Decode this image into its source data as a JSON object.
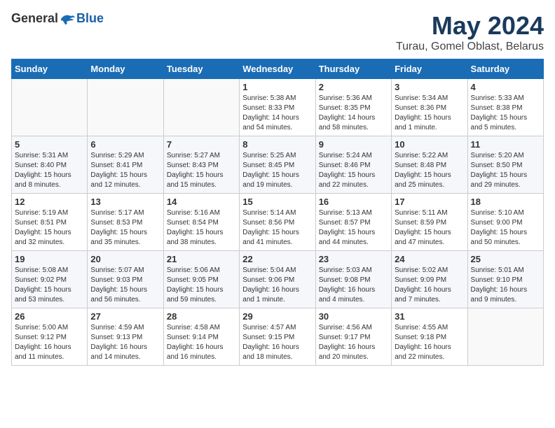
{
  "logo": {
    "general": "General",
    "blue": "Blue"
  },
  "title": "May 2024",
  "location": "Turau, Gomel Oblast, Belarus",
  "days_of_week": [
    "Sunday",
    "Monday",
    "Tuesday",
    "Wednesday",
    "Thursday",
    "Friday",
    "Saturday"
  ],
  "weeks": [
    [
      {
        "day": "",
        "info": ""
      },
      {
        "day": "",
        "info": ""
      },
      {
        "day": "",
        "info": ""
      },
      {
        "day": "1",
        "info": "Sunrise: 5:38 AM\nSunset: 8:33 PM\nDaylight: 14 hours\nand 54 minutes."
      },
      {
        "day": "2",
        "info": "Sunrise: 5:36 AM\nSunset: 8:35 PM\nDaylight: 14 hours\nand 58 minutes."
      },
      {
        "day": "3",
        "info": "Sunrise: 5:34 AM\nSunset: 8:36 PM\nDaylight: 15 hours\nand 1 minute."
      },
      {
        "day": "4",
        "info": "Sunrise: 5:33 AM\nSunset: 8:38 PM\nDaylight: 15 hours\nand 5 minutes."
      }
    ],
    [
      {
        "day": "5",
        "info": "Sunrise: 5:31 AM\nSunset: 8:40 PM\nDaylight: 15 hours\nand 8 minutes."
      },
      {
        "day": "6",
        "info": "Sunrise: 5:29 AM\nSunset: 8:41 PM\nDaylight: 15 hours\nand 12 minutes."
      },
      {
        "day": "7",
        "info": "Sunrise: 5:27 AM\nSunset: 8:43 PM\nDaylight: 15 hours\nand 15 minutes."
      },
      {
        "day": "8",
        "info": "Sunrise: 5:25 AM\nSunset: 8:45 PM\nDaylight: 15 hours\nand 19 minutes."
      },
      {
        "day": "9",
        "info": "Sunrise: 5:24 AM\nSunset: 8:46 PM\nDaylight: 15 hours\nand 22 minutes."
      },
      {
        "day": "10",
        "info": "Sunrise: 5:22 AM\nSunset: 8:48 PM\nDaylight: 15 hours\nand 25 minutes."
      },
      {
        "day": "11",
        "info": "Sunrise: 5:20 AM\nSunset: 8:50 PM\nDaylight: 15 hours\nand 29 minutes."
      }
    ],
    [
      {
        "day": "12",
        "info": "Sunrise: 5:19 AM\nSunset: 8:51 PM\nDaylight: 15 hours\nand 32 minutes."
      },
      {
        "day": "13",
        "info": "Sunrise: 5:17 AM\nSunset: 8:53 PM\nDaylight: 15 hours\nand 35 minutes."
      },
      {
        "day": "14",
        "info": "Sunrise: 5:16 AM\nSunset: 8:54 PM\nDaylight: 15 hours\nand 38 minutes."
      },
      {
        "day": "15",
        "info": "Sunrise: 5:14 AM\nSunset: 8:56 PM\nDaylight: 15 hours\nand 41 minutes."
      },
      {
        "day": "16",
        "info": "Sunrise: 5:13 AM\nSunset: 8:57 PM\nDaylight: 15 hours\nand 44 minutes."
      },
      {
        "day": "17",
        "info": "Sunrise: 5:11 AM\nSunset: 8:59 PM\nDaylight: 15 hours\nand 47 minutes."
      },
      {
        "day": "18",
        "info": "Sunrise: 5:10 AM\nSunset: 9:00 PM\nDaylight: 15 hours\nand 50 minutes."
      }
    ],
    [
      {
        "day": "19",
        "info": "Sunrise: 5:08 AM\nSunset: 9:02 PM\nDaylight: 15 hours\nand 53 minutes."
      },
      {
        "day": "20",
        "info": "Sunrise: 5:07 AM\nSunset: 9:03 PM\nDaylight: 15 hours\nand 56 minutes."
      },
      {
        "day": "21",
        "info": "Sunrise: 5:06 AM\nSunset: 9:05 PM\nDaylight: 15 hours\nand 59 minutes."
      },
      {
        "day": "22",
        "info": "Sunrise: 5:04 AM\nSunset: 9:06 PM\nDaylight: 16 hours\nand 1 minute."
      },
      {
        "day": "23",
        "info": "Sunrise: 5:03 AM\nSunset: 9:08 PM\nDaylight: 16 hours\nand 4 minutes."
      },
      {
        "day": "24",
        "info": "Sunrise: 5:02 AM\nSunset: 9:09 PM\nDaylight: 16 hours\nand 7 minutes."
      },
      {
        "day": "25",
        "info": "Sunrise: 5:01 AM\nSunset: 9:10 PM\nDaylight: 16 hours\nand 9 minutes."
      }
    ],
    [
      {
        "day": "26",
        "info": "Sunrise: 5:00 AM\nSunset: 9:12 PM\nDaylight: 16 hours\nand 11 minutes."
      },
      {
        "day": "27",
        "info": "Sunrise: 4:59 AM\nSunset: 9:13 PM\nDaylight: 16 hours\nand 14 minutes."
      },
      {
        "day": "28",
        "info": "Sunrise: 4:58 AM\nSunset: 9:14 PM\nDaylight: 16 hours\nand 16 minutes."
      },
      {
        "day": "29",
        "info": "Sunrise: 4:57 AM\nSunset: 9:15 PM\nDaylight: 16 hours\nand 18 minutes."
      },
      {
        "day": "30",
        "info": "Sunrise: 4:56 AM\nSunset: 9:17 PM\nDaylight: 16 hours\nand 20 minutes."
      },
      {
        "day": "31",
        "info": "Sunrise: 4:55 AM\nSunset: 9:18 PM\nDaylight: 16 hours\nand 22 minutes."
      },
      {
        "day": "",
        "info": ""
      }
    ]
  ]
}
